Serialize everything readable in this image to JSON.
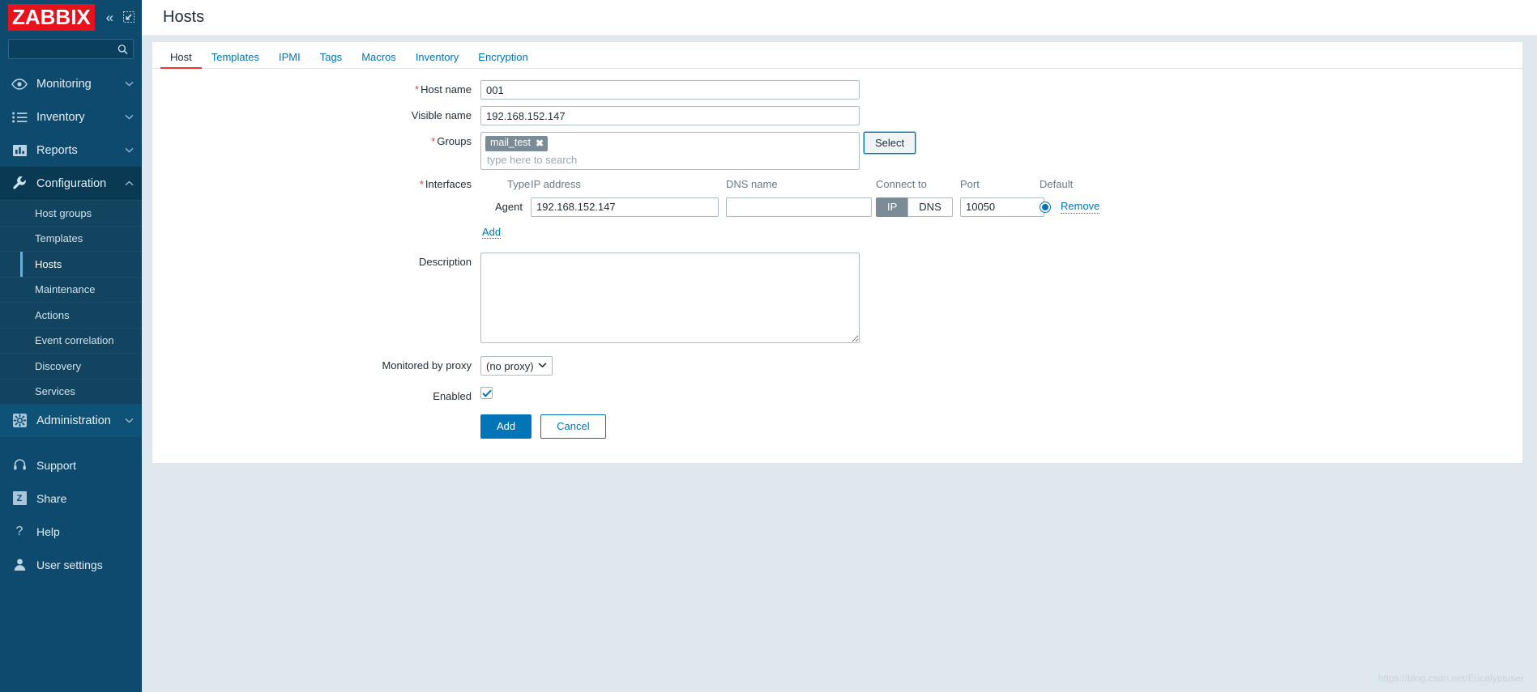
{
  "sidebar": {
    "logo": "ZABBIX",
    "collapse_icon": "chevron-double-left-icon",
    "expand_icon": "collapse-panel-icon",
    "search": {
      "value": "",
      "placeholder": ""
    },
    "nav": [
      {
        "label": "Monitoring",
        "icon": "eye-icon",
        "expandable": true
      },
      {
        "label": "Inventory",
        "icon": "list-icon",
        "expandable": true
      },
      {
        "label": "Reports",
        "icon": "bar-chart-icon",
        "expandable": true
      },
      {
        "label": "Configuration",
        "icon": "wrench-icon",
        "expandable": true,
        "expanded": true
      }
    ],
    "submenu": [
      {
        "label": "Host groups"
      },
      {
        "label": "Templates"
      },
      {
        "label": "Hosts",
        "active": true
      },
      {
        "label": "Maintenance"
      },
      {
        "label": "Actions"
      },
      {
        "label": "Event correlation"
      },
      {
        "label": "Discovery"
      },
      {
        "label": "Services"
      }
    ],
    "administration": {
      "label": "Administration",
      "icon": "gear-icon"
    },
    "bottom": [
      {
        "label": "Support",
        "icon": "headset-icon"
      },
      {
        "label": "Share",
        "icon": "zabbix-z-icon"
      },
      {
        "label": "Help",
        "icon": "question-mark-icon"
      },
      {
        "label": "User settings",
        "icon": "person-icon"
      }
    ]
  },
  "header": {
    "title": "Hosts"
  },
  "tabs": [
    {
      "label": "Host",
      "active": true
    },
    {
      "label": "Templates",
      "active": false
    },
    {
      "label": "IPMI",
      "active": false
    },
    {
      "label": "Tags",
      "active": false
    },
    {
      "label": "Macros",
      "active": false
    },
    {
      "label": "Inventory",
      "active": false
    },
    {
      "label": "Encryption",
      "active": false
    }
  ],
  "form": {
    "host_name": {
      "label": "Host name",
      "required": true,
      "value": "001"
    },
    "visible_name": {
      "label": "Visible name",
      "required": false,
      "value": "192.168.152.147"
    },
    "groups": {
      "label": "Groups",
      "required": true,
      "chips": [
        {
          "text": "mail_test",
          "remove_icon": "close-icon"
        }
      ],
      "placeholder": "type here to search",
      "select_button": "Select"
    },
    "interfaces": {
      "label": "Interfaces",
      "required": true,
      "columns": [
        "Type",
        "IP address",
        "DNS name",
        "Connect to",
        "Port",
        "Default"
      ],
      "rows": [
        {
          "type": "Agent",
          "ip": "192.168.152.147",
          "dns": "",
          "connect_to": {
            "options": [
              "IP",
              "DNS"
            ],
            "selected": "IP"
          },
          "port": "10050",
          "default_selected": true,
          "remove_label": "Remove"
        }
      ],
      "add_label": "Add"
    },
    "description": {
      "label": "Description",
      "value": ""
    },
    "proxy": {
      "label": "Monitored by proxy",
      "selected": "(no proxy)",
      "options": [
        "(no proxy)"
      ]
    },
    "enabled": {
      "label": "Enabled",
      "checked": true
    },
    "actions": {
      "submit": "Add",
      "cancel": "Cancel"
    }
  },
  "watermark": "https://blog.csdn.net/Eucalyptuser"
}
